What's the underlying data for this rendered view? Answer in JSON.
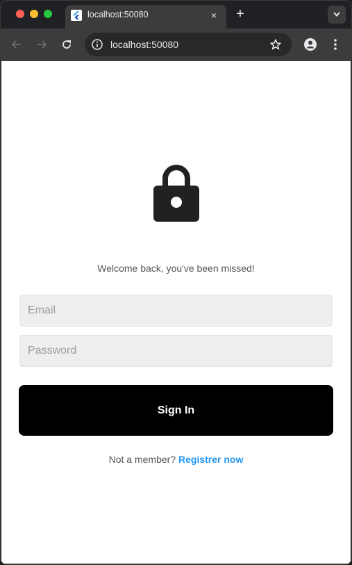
{
  "browser": {
    "tab_title": "localhost:50080",
    "url": "localhost:50080",
    "close_glyph": "×",
    "new_tab_glyph": "+"
  },
  "page": {
    "welcome_text": "Welcome back, you've been missed!",
    "email_placeholder": "Email",
    "password_placeholder": "Password",
    "sign_in_label": "Sign In",
    "register_prefix": "Not a member?",
    "register_link": "Registrer now"
  },
  "icons": {
    "lock": "lock-icon",
    "back": "arrow-left-icon",
    "forward": "arrow-right-icon",
    "reload": "reload-icon"
  },
  "colors": {
    "link": "#2196f3",
    "button": "#000000",
    "field_bg": "#eeeeee"
  }
}
